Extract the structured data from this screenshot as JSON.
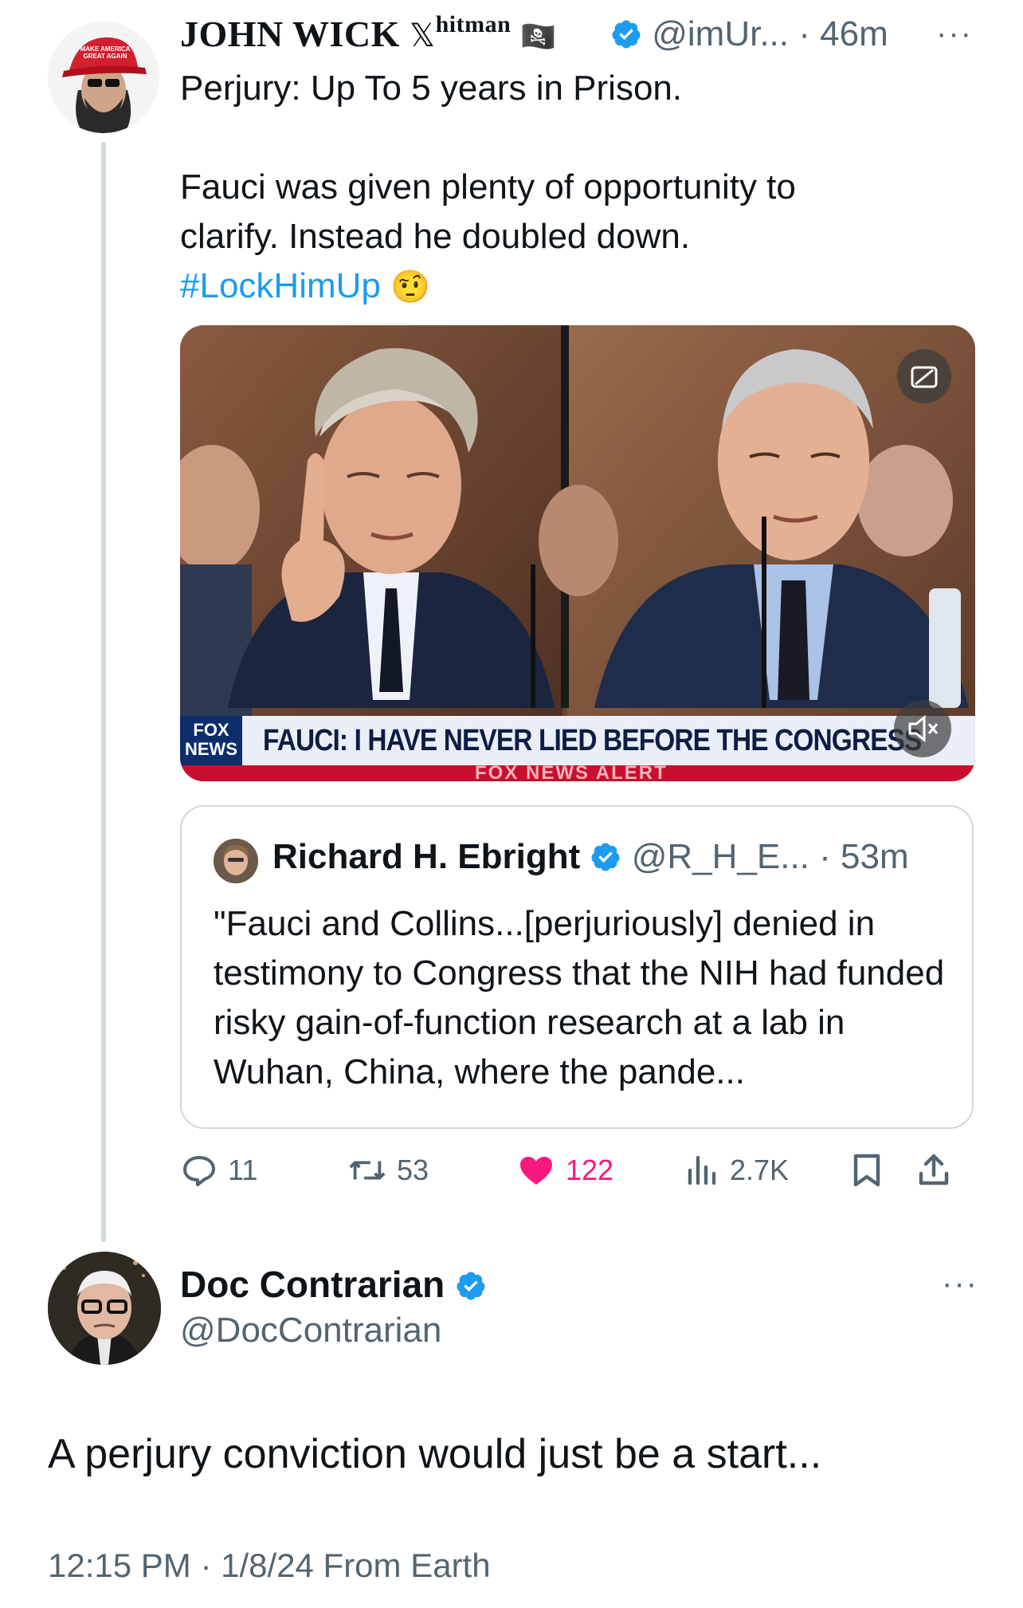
{
  "tweet": {
    "author_name": "JOHN WICK",
    "author_x_glyph": "𝕏",
    "author_suffix": "hitman",
    "author_flag": "🏴‍☠️",
    "handle": "@imUr...",
    "time": "· 46m",
    "more": "···",
    "hat_text": "MAKE AMERICA GREAT AGAIN",
    "text_line1": "Perjury: Up To 5 years in Prison.",
    "text_line2": "Fauci was given plenty of opportunity to",
    "text_line3": "clarify.  Instead he doubled down.",
    "hashtag": "#LockHimUp",
    "emoji": "🤨",
    "media": {
      "cc_label": "CC",
      "fox_logo": "FOX NEWS",
      "chyron": "FAUCI: I HAVE NEVER LIED BEFORE THE CONGRESS",
      "alert": "FOX NEWS ALERT"
    },
    "quote": {
      "name": "Richard H. Ebright",
      "handle": "@R_H_E...",
      "time": "· 53m",
      "text": "\"Fauci and Collins...[perjuriously] denied in testimony to Congress that the NIH had funded risky gain-of-function research at a lab in Wuhan, China, where the pande..."
    },
    "actions": {
      "replies": "11",
      "reposts": "53",
      "likes": "122",
      "views": "2.7K"
    }
  },
  "reply": {
    "name": "Doc Contrarian",
    "handle": "@DocContrarian",
    "more": "···",
    "text": "A perjury conviction would just be a start...",
    "meta": "12:15 PM · 1/8/24 From Earth"
  },
  "colors": {
    "accent": "#1d9bf0",
    "like": "#f91880",
    "muted": "#536471",
    "border": "#cfd9de"
  }
}
